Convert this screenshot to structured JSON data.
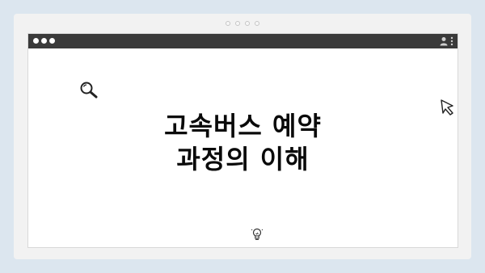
{
  "pager": {
    "count": 4
  },
  "window": {
    "controls": [
      "close-dot",
      "minimize-dot",
      "maximize-dot"
    ],
    "titlebar_icons": [
      "user-icon",
      "kebab-menu-icon"
    ]
  },
  "content": {
    "title_line1": "고속버스 예약",
    "title_line2": "과정의 이해",
    "decorations": [
      "search-icon",
      "cursor-icon",
      "lightbulb-icon"
    ]
  },
  "colors": {
    "background": "#dce6ef",
    "card": "#f2f2f2",
    "titlebar": "#3a3a3a",
    "window": "#ffffff",
    "text": "#0a0a0a"
  }
}
